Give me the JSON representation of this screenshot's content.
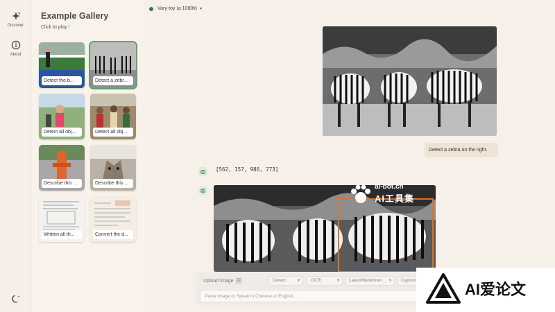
{
  "nav": {
    "discover_label": "Discover",
    "about_label": "About"
  },
  "gallery": {
    "title": "Example Gallery",
    "subtitle": "Click to play !",
    "items": [
      {
        "caption": "Detect the b..."
      },
      {
        "caption": "Detect a zebr..."
      },
      {
        "caption": "Detect all obj..."
      },
      {
        "caption": "Detect all obj..."
      },
      {
        "caption": "Describe this ..."
      },
      {
        "caption": "Describe this ..."
      },
      {
        "caption": "Written all th..."
      },
      {
        "caption": "Convert the d..."
      }
    ]
  },
  "header": {
    "model_name": "Vary-toy (a 1080ti)",
    "status_color": "#2f7d48"
  },
  "chat": {
    "user_message": "Detect a zebra on the right.",
    "bot_response": "[562, 157, 986, 773]"
  },
  "composer": {
    "upload_label": "Upload Image",
    "modes": [
      "Detect",
      "OCR",
      "Latex/Markdown",
      "Caption"
    ],
    "placeholder": "Paste Image or Speak in Chinese or English..."
  },
  "watermark": {
    "top_line1": "ai-bot.cn",
    "top_line2": "AI工具集",
    "corner_text": "AI爱论文"
  },
  "colors": {
    "accent": "#5fa36c",
    "background": "#f7f0e9"
  }
}
